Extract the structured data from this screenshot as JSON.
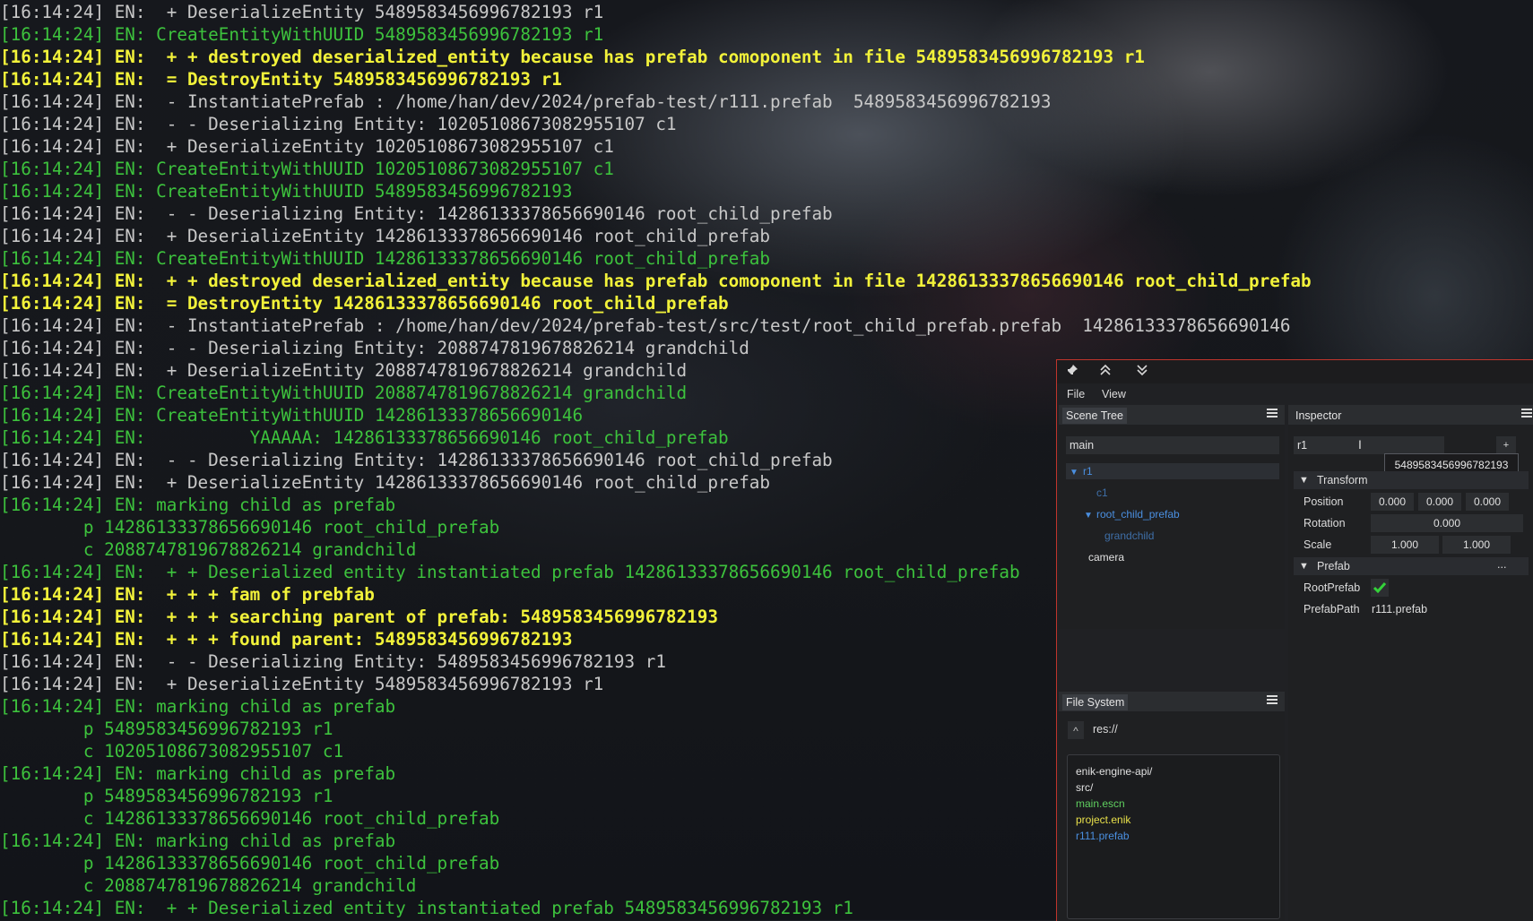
{
  "log": {
    "lines": [
      {
        "text": "[16:14:24] EN:  + DeserializeEntity 5489583456996782193 r1",
        "color": "gray"
      },
      {
        "text": "[16:14:24] EN: CreateEntityWithUUID 5489583456996782193 r1",
        "color": "green"
      },
      {
        "text": "[16:14:24] EN:  + + destroyed deserialized_entity because has prefab comoponent in file 5489583456996782193 r1",
        "color": "yellow"
      },
      {
        "text": "[16:14:24] EN:  = DestroyEntity 5489583456996782193 r1",
        "color": "yellow"
      },
      {
        "text": "[16:14:24] EN:  - InstantiatePrefab : /home/han/dev/2024/prefab-test/r111.prefab  5489583456996782193",
        "color": "gray"
      },
      {
        "text": "[16:14:24] EN:  - - Deserializing Entity: 10205108673082955107 c1",
        "color": "gray"
      },
      {
        "text": "[16:14:24] EN:  + DeserializeEntity 10205108673082955107 c1",
        "color": "gray"
      },
      {
        "text": "[16:14:24] EN: CreateEntityWithUUID 10205108673082955107 c1",
        "color": "green"
      },
      {
        "text": "[16:14:24] EN: CreateEntityWithUUID 5489583456996782193",
        "color": "green"
      },
      {
        "text": "[16:14:24] EN:  - - Deserializing Entity: 14286133378656690146 root_child_prefab",
        "color": "gray"
      },
      {
        "text": "[16:14:24] EN:  + DeserializeEntity 14286133378656690146 root_child_prefab",
        "color": "gray"
      },
      {
        "text": "[16:14:24] EN: CreateEntityWithUUID 14286133378656690146 root_child_prefab",
        "color": "green"
      },
      {
        "text": "[16:14:24] EN:  + + destroyed deserialized_entity because has prefab comoponent in file 14286133378656690146 root_child_prefab",
        "color": "yellow"
      },
      {
        "text": "[16:14:24] EN:  = DestroyEntity 14286133378656690146 root_child_prefab",
        "color": "yellow"
      },
      {
        "text": "[16:14:24] EN:  - InstantiatePrefab : /home/han/dev/2024/prefab-test/src/test/root_child_prefab.prefab  14286133378656690146",
        "color": "gray"
      },
      {
        "text": "[16:14:24] EN:  - - Deserializing Entity: 2088747819678826214 grandchild",
        "color": "gray"
      },
      {
        "text": "[16:14:24] EN:  + DeserializeEntity 2088747819678826214 grandchild",
        "color": "gray"
      },
      {
        "text": "[16:14:24] EN: CreateEntityWithUUID 2088747819678826214 grandchild",
        "color": "green"
      },
      {
        "text": "[16:14:24] EN: CreateEntityWithUUID 14286133378656690146",
        "color": "green"
      },
      {
        "text": "[16:14:24] EN:          YAAAAA: 14286133378656690146 root_child_prefab",
        "color": "green"
      },
      {
        "text": "[16:14:24] EN:  - - Deserializing Entity: 14286133378656690146 root_child_prefab",
        "color": "gray"
      },
      {
        "text": "[16:14:24] EN:  + DeserializeEntity 14286133378656690146 root_child_prefab",
        "color": "gray"
      },
      {
        "text": "[16:14:24] EN: marking child as prefab",
        "color": "green"
      },
      {
        "text": "        p 14286133378656690146 root_child_prefab",
        "color": "green"
      },
      {
        "text": "        c 2088747819678826214 grandchild",
        "color": "green"
      },
      {
        "text": "[16:14:24] EN:  + + Deserialized entity instantiated prefab 14286133378656690146 root_child_prefab",
        "color": "green"
      },
      {
        "text": "[16:14:24] EN:  + + + fam of prebfab",
        "color": "yellow"
      },
      {
        "text": "[16:14:24] EN:  + + + searching parent of prefab: 5489583456996782193",
        "color": "yellow"
      },
      {
        "text": "[16:14:24] EN:  + + + found parent: 5489583456996782193",
        "color": "yellow"
      },
      {
        "text": "[16:14:24] EN:  - - Deserializing Entity: 5489583456996782193 r1",
        "color": "gray"
      },
      {
        "text": "[16:14:24] EN:  + DeserializeEntity 5489583456996782193 r1",
        "color": "gray"
      },
      {
        "text": "[16:14:24] EN: marking child as prefab",
        "color": "green"
      },
      {
        "text": "        p 5489583456996782193 r1",
        "color": "green"
      },
      {
        "text": "        c 10205108673082955107 c1",
        "color": "green"
      },
      {
        "text": "[16:14:24] EN: marking child as prefab",
        "color": "green"
      },
      {
        "text": "        p 5489583456996782193 r1",
        "color": "green"
      },
      {
        "text": "        c 14286133378656690146 root_child_prefab",
        "color": "green"
      },
      {
        "text": "[16:14:24] EN: marking child as prefab",
        "color": "green"
      },
      {
        "text": "        p 14286133378656690146 root_child_prefab",
        "color": "green"
      },
      {
        "text": "        c 2088747819678826214 grandchild",
        "color": "green"
      },
      {
        "text": "[16:14:24] EN:  + + Deserialized entity instantiated prefab 5489583456996782193 r1",
        "color": "green"
      }
    ]
  },
  "editor": {
    "titlebar": {
      "icons": [
        "pin-icon",
        "chevron-double-up-icon",
        "chevron-double-down-icon"
      ]
    },
    "menu": {
      "file": "File",
      "view": "View"
    },
    "scene_tree": {
      "tab": "Scene Tree",
      "filter": "main",
      "nodes": [
        {
          "label": "r1",
          "color": "#4a8fe0",
          "expanded": true,
          "selected": true
        },
        {
          "label": "c1",
          "color": "#3f6fa8"
        },
        {
          "label": "root_child_prefab",
          "color": "#4a8fe0",
          "expanded": true
        },
        {
          "label": "grandchild",
          "color": "#3f6fa8"
        },
        {
          "label": "camera",
          "color": "#e0e0e0"
        }
      ]
    },
    "inspector": {
      "tab": "Inspector",
      "name_value": "r1",
      "add_button": "+",
      "tooltip": "5489583456996782193",
      "transform": {
        "title": "Transform",
        "position_label": "Position",
        "position": [
          "0.000",
          "0.000",
          "0.000"
        ],
        "rotation_label": "Rotation",
        "rotation": "0.000",
        "scale_label": "Scale",
        "scale": [
          "1.000",
          "1.000"
        ]
      },
      "prefab": {
        "title": "Prefab",
        "more": "...",
        "root_prefab_label": "RootPrefab",
        "root_prefab_checked": true,
        "prefab_path_label": "PrefabPath",
        "prefab_path_value": "r111.prefab"
      }
    },
    "file_system": {
      "tab": "File System",
      "up_button": "^",
      "path": "res://",
      "entries": [
        {
          "name": "enik-engine-api/",
          "color": "#e0e0e0"
        },
        {
          "name": "src/",
          "color": "#e0e0e0"
        },
        {
          "name": "main.escn",
          "color": "#5fcf5f"
        },
        {
          "name": "project.enik",
          "color": "#e8e04a"
        },
        {
          "name": "r111.prefab",
          "color": "#4a8fe0"
        }
      ]
    }
  }
}
